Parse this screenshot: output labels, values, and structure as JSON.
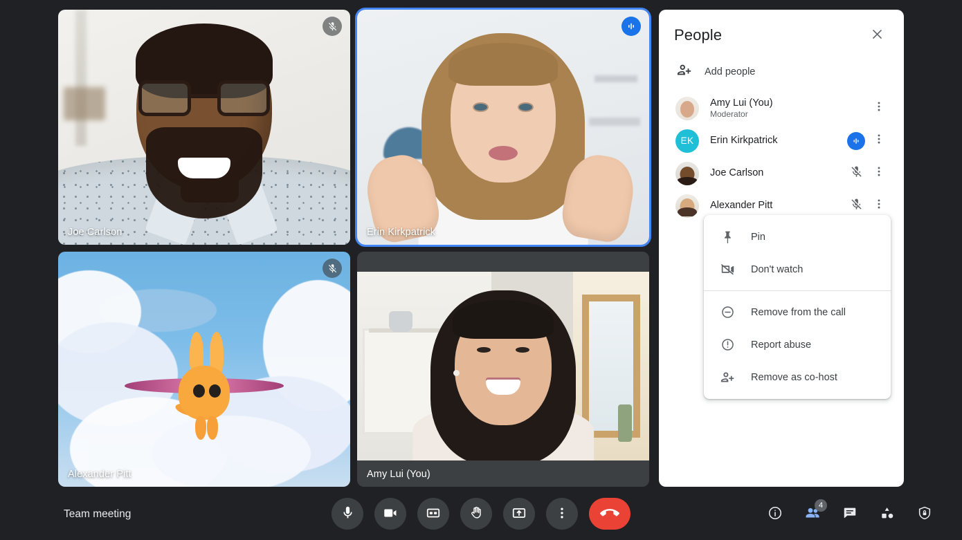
{
  "meeting": {
    "title": "Team meeting"
  },
  "tiles": [
    {
      "name": "Joe Carlson",
      "status_icon": "mic-off-icon",
      "status": "muted",
      "active": false
    },
    {
      "name": "Erin Kirkpatrick",
      "status_icon": "speaking-icon",
      "status": "speaking",
      "active": true
    },
    {
      "name": "Alexander Pitt",
      "status_icon": "mic-off-icon",
      "status": "muted",
      "active": false
    },
    {
      "name": "Amy Lui (You)",
      "status_icon": "",
      "status": "none",
      "active": false
    }
  ],
  "people_panel": {
    "title": "People",
    "close_icon": "close-icon",
    "add_people": {
      "label": "Add people",
      "icon": "person-add-icon"
    },
    "participants": [
      {
        "name": "Amy Lui (You)",
        "role": "Moderator",
        "avatar_type": "photo",
        "avatar_color": "",
        "initials": "",
        "status_icon": "none",
        "more_icon": "more-vert-icon"
      },
      {
        "name": "Erin Kirkpatrick",
        "role": "",
        "avatar_type": "initials",
        "avatar_color": "#1fbfd8",
        "initials": "EK",
        "status_icon": "speaking-icon",
        "more_icon": "more-vert-icon"
      },
      {
        "name": "Joe Carlson",
        "role": "",
        "avatar_type": "photo",
        "avatar_color": "",
        "initials": "",
        "status_icon": "mic-off-icon",
        "more_icon": "more-vert-icon"
      },
      {
        "name": "Alexander Pitt",
        "role": "",
        "avatar_type": "photo",
        "avatar_color": "",
        "initials": "",
        "status_icon": "mic-off-icon",
        "more_icon": "more-vert-icon"
      }
    ]
  },
  "context_menu": {
    "groups": [
      [
        {
          "label": "Pin",
          "icon": "pin-icon"
        },
        {
          "label": "Don't watch",
          "icon": "video-off-icon"
        }
      ],
      [
        {
          "label": "Remove from the call",
          "icon": "remove-circle-icon"
        },
        {
          "label": "Report abuse",
          "icon": "exclamation-circle-icon"
        },
        {
          "label": "Remove as co-host",
          "icon": "person-add-icon"
        }
      ]
    ]
  },
  "controls": {
    "center": [
      {
        "name": "microphone",
        "icon": "mic-icon",
        "label": "Turn off microphone"
      },
      {
        "name": "camera",
        "icon": "video-icon",
        "label": "Turn off camera"
      },
      {
        "name": "captions",
        "icon": "closed-caption-icon",
        "label": "Turn on captions"
      },
      {
        "name": "raise-hand",
        "icon": "hand-icon",
        "label": "Raise hand"
      },
      {
        "name": "present",
        "icon": "present-icon",
        "label": "Present now"
      },
      {
        "name": "more",
        "icon": "more-vert-icon",
        "label": "More options"
      },
      {
        "name": "leave-call",
        "icon": "call-end-icon",
        "label": "Leave call"
      }
    ],
    "right": [
      {
        "name": "meeting-details",
        "icon": "info-icon",
        "label": "Meeting details",
        "badge": "",
        "active": false
      },
      {
        "name": "people",
        "icon": "people-icon",
        "label": "Show everyone",
        "badge": "4",
        "active": true
      },
      {
        "name": "chat",
        "icon": "chat-icon",
        "label": "Chat with everyone",
        "badge": "",
        "active": false
      },
      {
        "name": "activities",
        "icon": "activities-icon",
        "label": "Activities",
        "badge": "",
        "active": false
      },
      {
        "name": "host-controls",
        "icon": "shield-lock-icon",
        "label": "Host controls",
        "badge": "",
        "active": false
      }
    ]
  },
  "colors": {
    "background": "#1f2125",
    "accent_blue": "#1a73e8",
    "active_border": "#4285f4",
    "hangup_red": "#ea4335",
    "panel_white": "#ffffff",
    "tile_gray": "#3c4043",
    "people_active": "#8ab4f8"
  }
}
